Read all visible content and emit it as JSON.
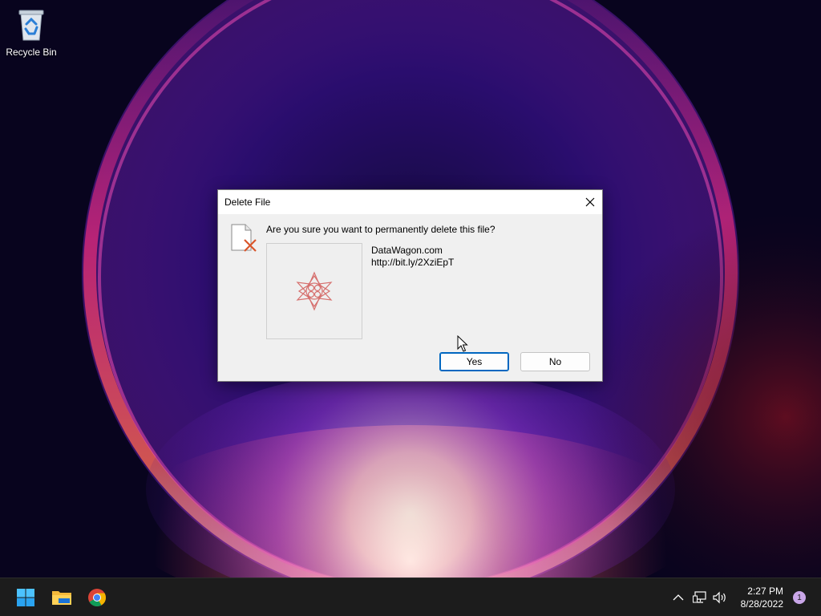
{
  "desktop": {
    "icons": [
      {
        "label": "Recycle Bin",
        "icon": "recycle-bin-icon"
      }
    ]
  },
  "dialog": {
    "title": "Delete File",
    "question": "Are you sure you want to permanently delete this file?",
    "file_name": "DataWagon.com",
    "file_detail": "http://bit.ly/2XziEpT",
    "yes_label": "Yes",
    "no_label": "No",
    "close_icon": "close-icon",
    "file_icon": "delete-file-icon"
  },
  "taskbar": {
    "apps": [
      {
        "name": "Start",
        "icon": "windows-start-icon"
      },
      {
        "name": "File Explorer",
        "icon": "folder-icon"
      },
      {
        "name": "Google Chrome",
        "icon": "chrome-icon"
      }
    ],
    "tray": {
      "time": "2:27 PM",
      "date": "8/28/2022",
      "notification_count": "1"
    }
  },
  "colors": {
    "accent": "#0067c0",
    "taskbar": "#1c1c1c",
    "dialog_bg": "#f0f0f0"
  }
}
